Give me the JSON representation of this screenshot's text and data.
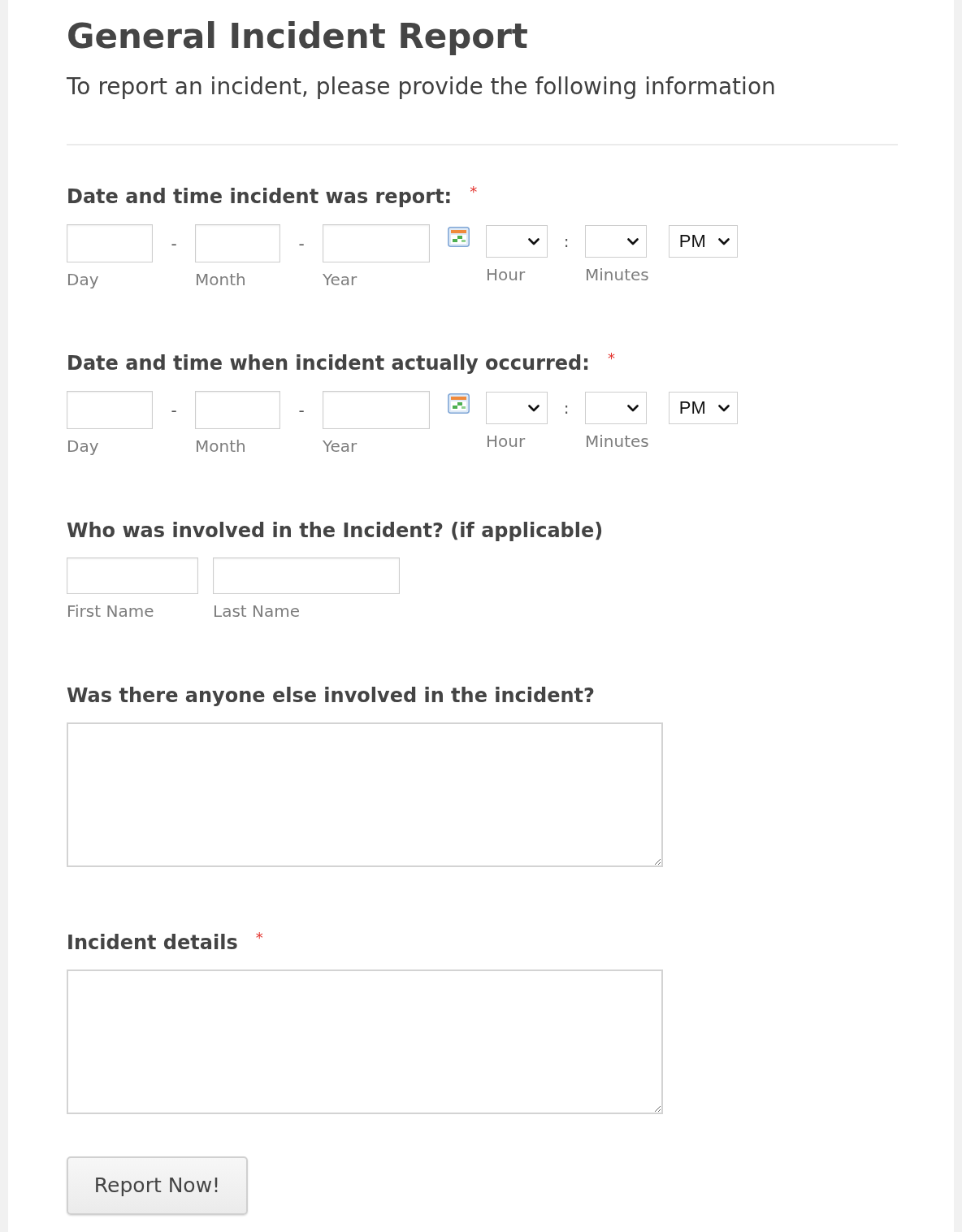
{
  "title": "General Incident Report",
  "subtitle": "To report an incident, please provide the following information",
  "fields": [
    {
      "kind": "datetime",
      "label": "Date and time incident was report:",
      "required_mark": "*",
      "date_inputs": [
        {
          "sublabel": "Day"
        },
        {
          "sublabel": "Month"
        },
        {
          "sublabel": "Year"
        }
      ],
      "date_separators": [
        "-",
        "-"
      ],
      "time_selects": [
        {
          "sublabel": "Hour"
        },
        {
          "sublabel": "Minutes"
        }
      ],
      "time_separator": ":",
      "meridiem_select": {
        "value": "PM"
      }
    },
    {
      "kind": "datetime",
      "label": "Date and time when incident actually occurred:",
      "required_mark": "*",
      "date_inputs": [
        {
          "sublabel": "Day"
        },
        {
          "sublabel": "Month"
        },
        {
          "sublabel": "Year"
        }
      ],
      "date_separators": [
        "-",
        "-"
      ],
      "time_selects": [
        {
          "sublabel": "Hour"
        },
        {
          "sublabel": "Minutes"
        }
      ],
      "time_separator": ":",
      "meridiem_select": {
        "value": "PM"
      }
    },
    {
      "kind": "name",
      "label": "Who was involved in the Incident? (if applicable)",
      "inputs": [
        {
          "sublabel": "First Name"
        },
        {
          "sublabel": "Last Name"
        }
      ]
    },
    {
      "kind": "textarea",
      "label": "Was there anyone else involved in the incident?"
    },
    {
      "kind": "textarea",
      "label": "Incident details",
      "required_mark": "*"
    }
  ],
  "submit_button": {
    "label": "Report Now!"
  }
}
